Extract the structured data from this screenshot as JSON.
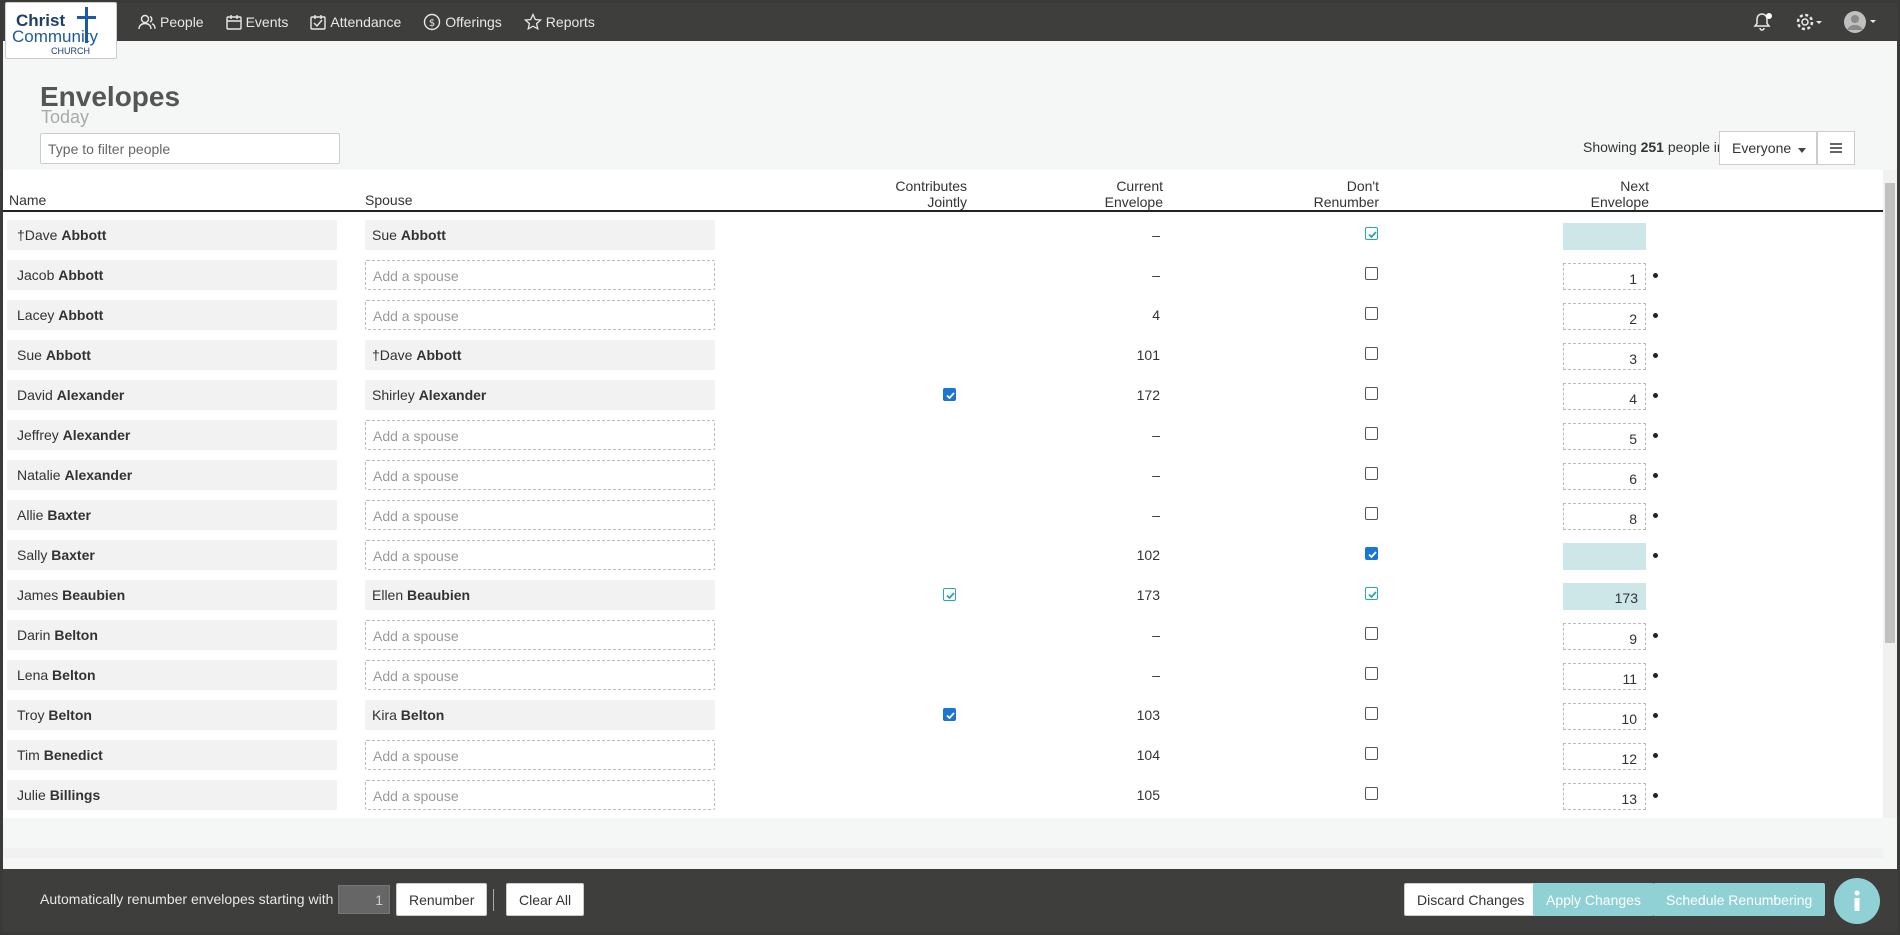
{
  "brand": {
    "line1": "Christ",
    "line2": "Community",
    "line3": "CHURCH"
  },
  "nav": [
    {
      "label": "People",
      "icon": "people-icon"
    },
    {
      "label": "Events",
      "icon": "calendar-icon"
    },
    {
      "label": "Attendance",
      "icon": "checklist-icon"
    },
    {
      "label": "Offerings",
      "icon": "money-icon"
    },
    {
      "label": "Reports",
      "icon": "star-icon"
    }
  ],
  "page": {
    "title": "Envelopes",
    "subtitle": "Today"
  },
  "filter": {
    "placeholder": "Type to filter people"
  },
  "showing": {
    "prefix": "Showing",
    "count": "251",
    "suffix": "people in",
    "group": "Everyone"
  },
  "columns": {
    "name": "Name",
    "spouse": "Spouse",
    "joint": [
      "Contributes",
      "Jointly"
    ],
    "current": [
      "Current",
      "Envelope"
    ],
    "dont": [
      "Don't",
      "Renumber"
    ],
    "next": [
      "Next",
      "Envelope"
    ]
  },
  "rows": [
    {
      "first": "†Dave",
      "last": "Abbott",
      "spouse_first": "Sue",
      "spouse_last": "Abbott",
      "joint": null,
      "current": "–",
      "dont": "teal",
      "next": "",
      "next_locked": true,
      "dot": false
    },
    {
      "first": "Jacob",
      "last": "Abbott",
      "spouse_first": "",
      "spouse_last": "",
      "joint": null,
      "current": "–",
      "dont": "off",
      "next": "1",
      "next_locked": false,
      "dot": true
    },
    {
      "first": "Lacey",
      "last": "Abbott",
      "spouse_first": "",
      "spouse_last": "",
      "joint": null,
      "current": "4",
      "dont": "off",
      "next": "2",
      "next_locked": false,
      "dot": true
    },
    {
      "first": "Sue",
      "last": "Abbott",
      "spouse_first": "†Dave",
      "spouse_last": "Abbott",
      "joint": null,
      "current": "101",
      "dont": "off",
      "next": "3",
      "next_locked": false,
      "dot": true
    },
    {
      "first": "David",
      "last": "Alexander",
      "spouse_first": "Shirley",
      "spouse_last": "Alexander",
      "joint": "on",
      "current": "172",
      "dont": "off",
      "next": "4",
      "next_locked": false,
      "dot": true
    },
    {
      "first": "Jeffrey",
      "last": "Alexander",
      "spouse_first": "",
      "spouse_last": "",
      "joint": null,
      "current": "–",
      "dont": "off",
      "next": "5",
      "next_locked": false,
      "dot": true
    },
    {
      "first": "Natalie",
      "last": "Alexander",
      "spouse_first": "",
      "spouse_last": "",
      "joint": null,
      "current": "–",
      "dont": "off",
      "next": "6",
      "next_locked": false,
      "dot": true
    },
    {
      "first": "Allie",
      "last": "Baxter",
      "spouse_first": "",
      "spouse_last": "",
      "joint": null,
      "current": "–",
      "dont": "off",
      "next": "8",
      "next_locked": false,
      "dot": true
    },
    {
      "first": "Sally",
      "last": "Baxter",
      "spouse_first": "",
      "spouse_last": "",
      "joint": null,
      "current": "102",
      "dont": "on",
      "next": "",
      "next_locked": true,
      "dot": true
    },
    {
      "first": "James",
      "last": "Beaubien",
      "spouse_first": "Ellen",
      "spouse_last": "Beaubien",
      "joint": "teal",
      "current": "173",
      "dont": "teal",
      "next": "173",
      "next_locked": true,
      "dot": false
    },
    {
      "first": "Darin",
      "last": "Belton",
      "spouse_first": "",
      "spouse_last": "",
      "joint": null,
      "current": "–",
      "dont": "off",
      "next": "9",
      "next_locked": false,
      "dot": true
    },
    {
      "first": "Lena",
      "last": "Belton",
      "spouse_first": "",
      "spouse_last": "",
      "joint": null,
      "current": "–",
      "dont": "off",
      "next": "11",
      "next_locked": false,
      "dot": true
    },
    {
      "first": "Troy",
      "last": "Belton",
      "spouse_first": "Kira",
      "spouse_last": "Belton",
      "joint": "on",
      "current": "103",
      "dont": "off",
      "next": "10",
      "next_locked": false,
      "dot": true
    },
    {
      "first": "Tim",
      "last": "Benedict",
      "spouse_first": "",
      "spouse_last": "",
      "joint": null,
      "current": "104",
      "dont": "off",
      "next": "12",
      "next_locked": false,
      "dot": true
    },
    {
      "first": "Julie",
      "last": "Billings",
      "spouse_first": "",
      "spouse_last": "",
      "joint": null,
      "current": "105",
      "dont": "off",
      "next": "13",
      "next_locked": false,
      "dot": true
    }
  ],
  "spouse_placeholder": "Add a spouse",
  "footer": {
    "renumber_label": "Automatically renumber envelopes starting with",
    "renumber_start": "1",
    "renumber_button": "Renumber",
    "clear_button": "Clear All",
    "discard_button": "Discard Changes",
    "apply_button": "Apply Changes",
    "schedule_button": "Schedule Renumbering"
  },
  "colors": {
    "accent": "#8fd1d5",
    "checkbox": "#1976d2",
    "teal_check": "#2aa7a7",
    "locked_bg": "#cde6e8"
  }
}
